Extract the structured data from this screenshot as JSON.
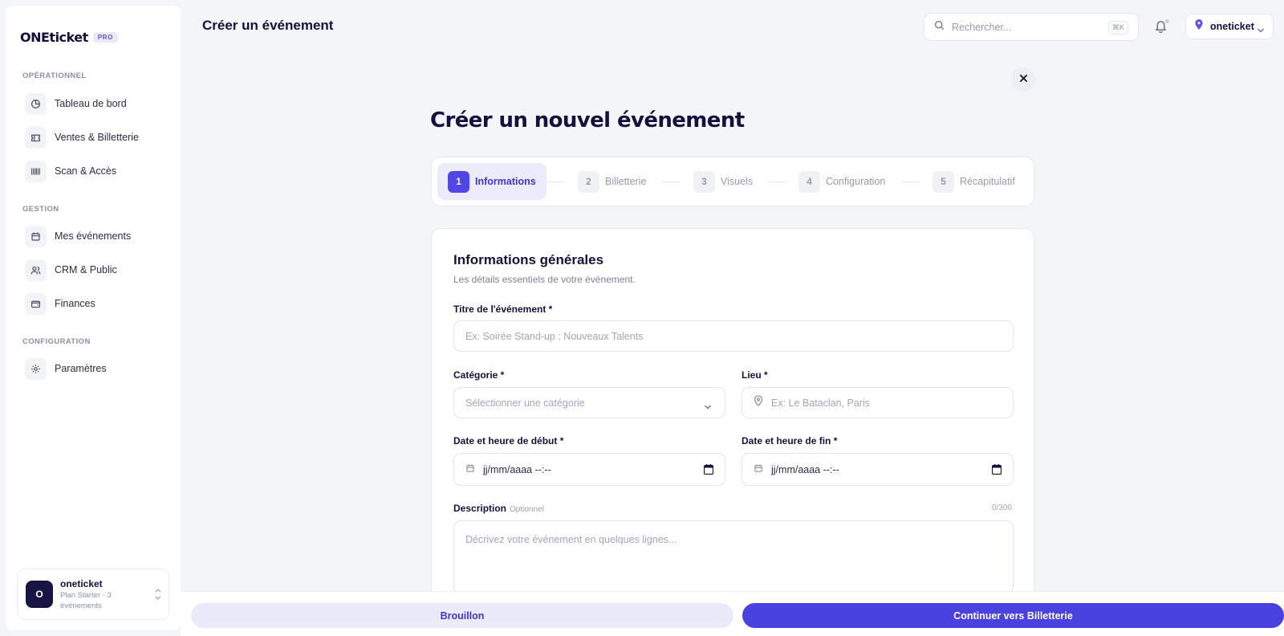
{
  "brand": {
    "name": "ONEticket",
    "badge": "PRO",
    "accent": "#4f46e5"
  },
  "sidebar": {
    "sections": [
      {
        "title": "OPÉRATIONNEL",
        "items": [
          {
            "label": "Tableau de bord",
            "icon": "pie-chart-icon"
          },
          {
            "label": "Ventes & Billetterie",
            "icon": "ticket-icon"
          },
          {
            "label": "Scan & Accès",
            "icon": "barcode-icon"
          }
        ]
      },
      {
        "title": "GESTION",
        "items": [
          {
            "label": "Mes événements",
            "icon": "calendar-icon"
          },
          {
            "label": "CRM & Public",
            "icon": "users-icon"
          },
          {
            "label": "Finances",
            "icon": "wallet-icon"
          }
        ]
      },
      {
        "title": "CONFIGURATION",
        "items": [
          {
            "label": "Paramètres",
            "icon": "gear-icon"
          }
        ]
      }
    ],
    "account": {
      "initial": "O",
      "name": "oneticket",
      "plan": "Plan Starter · 3 événements"
    }
  },
  "header": {
    "title": "Créer un événement",
    "search_placeholder": "Rechercher...",
    "search_shortcut": "⌘K",
    "org_name": "oneticket"
  },
  "main": {
    "title": "Créer un nouvel événement",
    "steps": [
      {
        "num": "1",
        "label": "Informations",
        "active": true
      },
      {
        "num": "2",
        "label": "Billetterie",
        "active": false
      },
      {
        "num": "3",
        "label": "Visuels",
        "active": false
      },
      {
        "num": "4",
        "label": "Configuration",
        "active": false
      },
      {
        "num": "5",
        "label": "Récapitulatif",
        "active": false
      }
    ]
  },
  "form": {
    "title": "Informations générales",
    "subtitle": "Les détails essentiels de votre événement.",
    "event_title": {
      "label": "Titre de l'événement *",
      "placeholder": "Ex: Soirée Stand-up : Nouveaux Talents"
    },
    "category": {
      "label": "Catégorie *",
      "placeholder": "Sélectionner une catégorie"
    },
    "venue": {
      "label": "Lieu *",
      "placeholder": "Ex: Le Bataclan, Paris"
    },
    "start": {
      "label": "Date et heure de début *",
      "value": "jj/mm/aaaa --:--"
    },
    "end": {
      "label": "Date et heure de fin *",
      "value": "jj/mm/aaaa --:--"
    },
    "description": {
      "label": "Description",
      "optional": "Optionnel",
      "counter": "0/300",
      "placeholder": "Décrivez votre événement en quelques lignes..."
    }
  },
  "footer": {
    "draft_label": "Brouillon",
    "next_label": "Continuer vers Billetterie"
  }
}
